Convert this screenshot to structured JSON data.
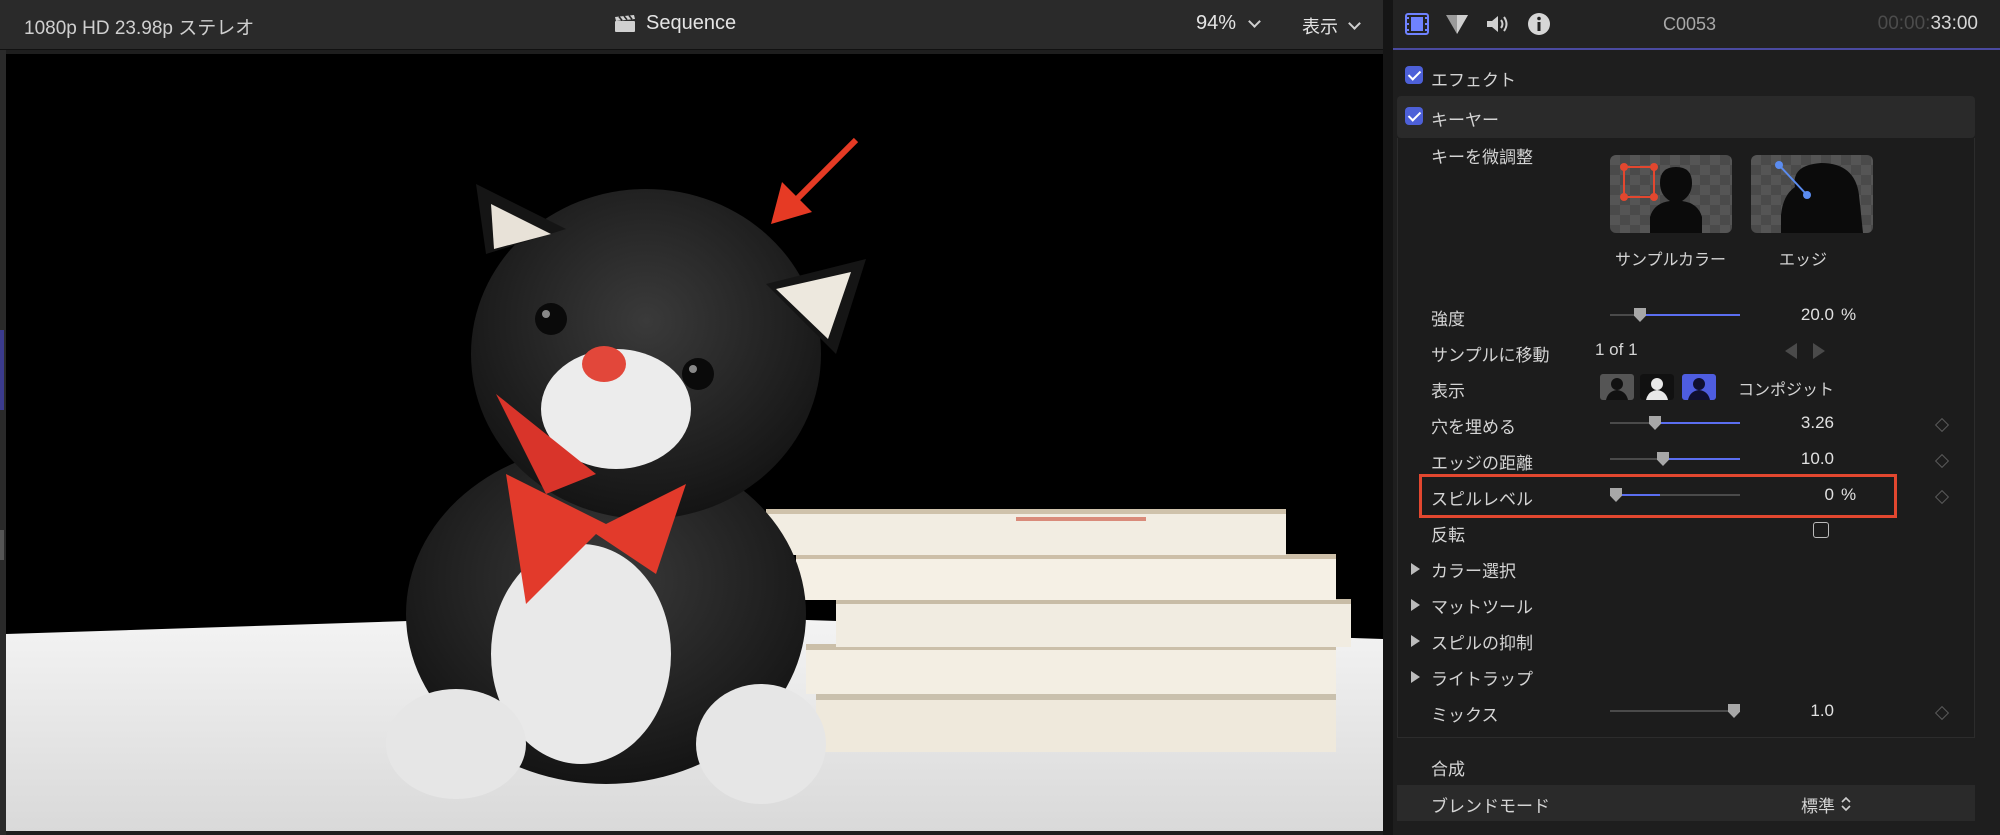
{
  "viewer": {
    "format": "1080p HD 23.98p ステレオ",
    "sequence": "Sequence",
    "zoom": "94%",
    "view_menu": "表示"
  },
  "inspector": {
    "clip_name": "C0053",
    "duration_dim": "00:00:",
    "duration_bright": "33:00",
    "effects_label": "エフェクト",
    "keyer_label": "キーヤー",
    "refine_key": {
      "label": "キーを微調整",
      "sample_color": "サンプルカラー",
      "edge": "エッジ"
    },
    "strength": {
      "label": "強度",
      "value": "20.0",
      "unit": "%",
      "fraction": 0.2
    },
    "jump_to_sample": {
      "label": "サンプルに移動",
      "value": "1 of 1"
    },
    "view": {
      "label": "表示",
      "mode": "コンポジット"
    },
    "fill_holes": {
      "label": "穴を埋める",
      "value": "3.26",
      "fraction": 0.33
    },
    "edge_distance": {
      "label": "エッジの距離",
      "value": "10.0",
      "fraction": 0.4
    },
    "spill_level": {
      "label": "スピルレベル",
      "value": "0",
      "unit": "%",
      "fraction": 0.0
    },
    "invert": {
      "label": "反転"
    },
    "groups": [
      "カラー選択",
      "マットツール",
      "スピルの抑制",
      "ライトラップ"
    ],
    "mix": {
      "label": "ミックス",
      "value": "1.0",
      "fraction": 1.0
    },
    "compositing": {
      "label": "合成",
      "blend_mode_label": "ブレンドモード",
      "blend_mode_value": "標準"
    }
  },
  "colors": {
    "accent": "#5b6ef0",
    "highlight": "#e2472f"
  },
  "icons": [
    "film-icon",
    "color-filter-icon",
    "speaker-icon",
    "info-icon",
    "clapper-icon"
  ]
}
